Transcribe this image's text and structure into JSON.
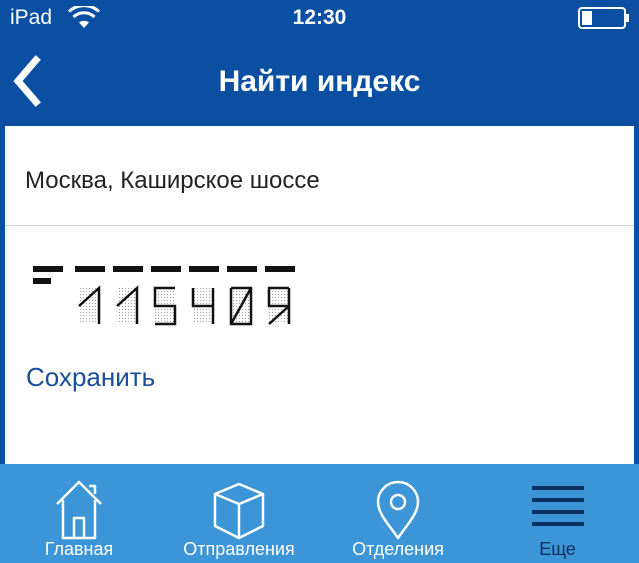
{
  "status_bar": {
    "carrier": "iPad",
    "time": "12:30",
    "wifi_icon": "wifi-icon",
    "battery_icon": "battery-icon"
  },
  "nav": {
    "title": "Найти индекс",
    "back_icon": "chevron-left-icon"
  },
  "content": {
    "address": "Москва, Каширское шоссе",
    "postcode": "115409",
    "save_label": "Сохранить"
  },
  "tabs": [
    {
      "label": "Главная",
      "icon": "home-icon",
      "active": false
    },
    {
      "label": "Отправления",
      "icon": "parcel-box-icon",
      "active": false
    },
    {
      "label": "Отделения",
      "icon": "map-pin-icon",
      "active": false
    },
    {
      "label": "Еще",
      "icon": "menu-icon",
      "active": true
    }
  ],
  "colors": {
    "header_blue": "#0b4fa3",
    "tab_bar_blue": "#3b95d6",
    "link_blue": "#1a4e98",
    "active_tab_label": "#0b2f5e"
  }
}
